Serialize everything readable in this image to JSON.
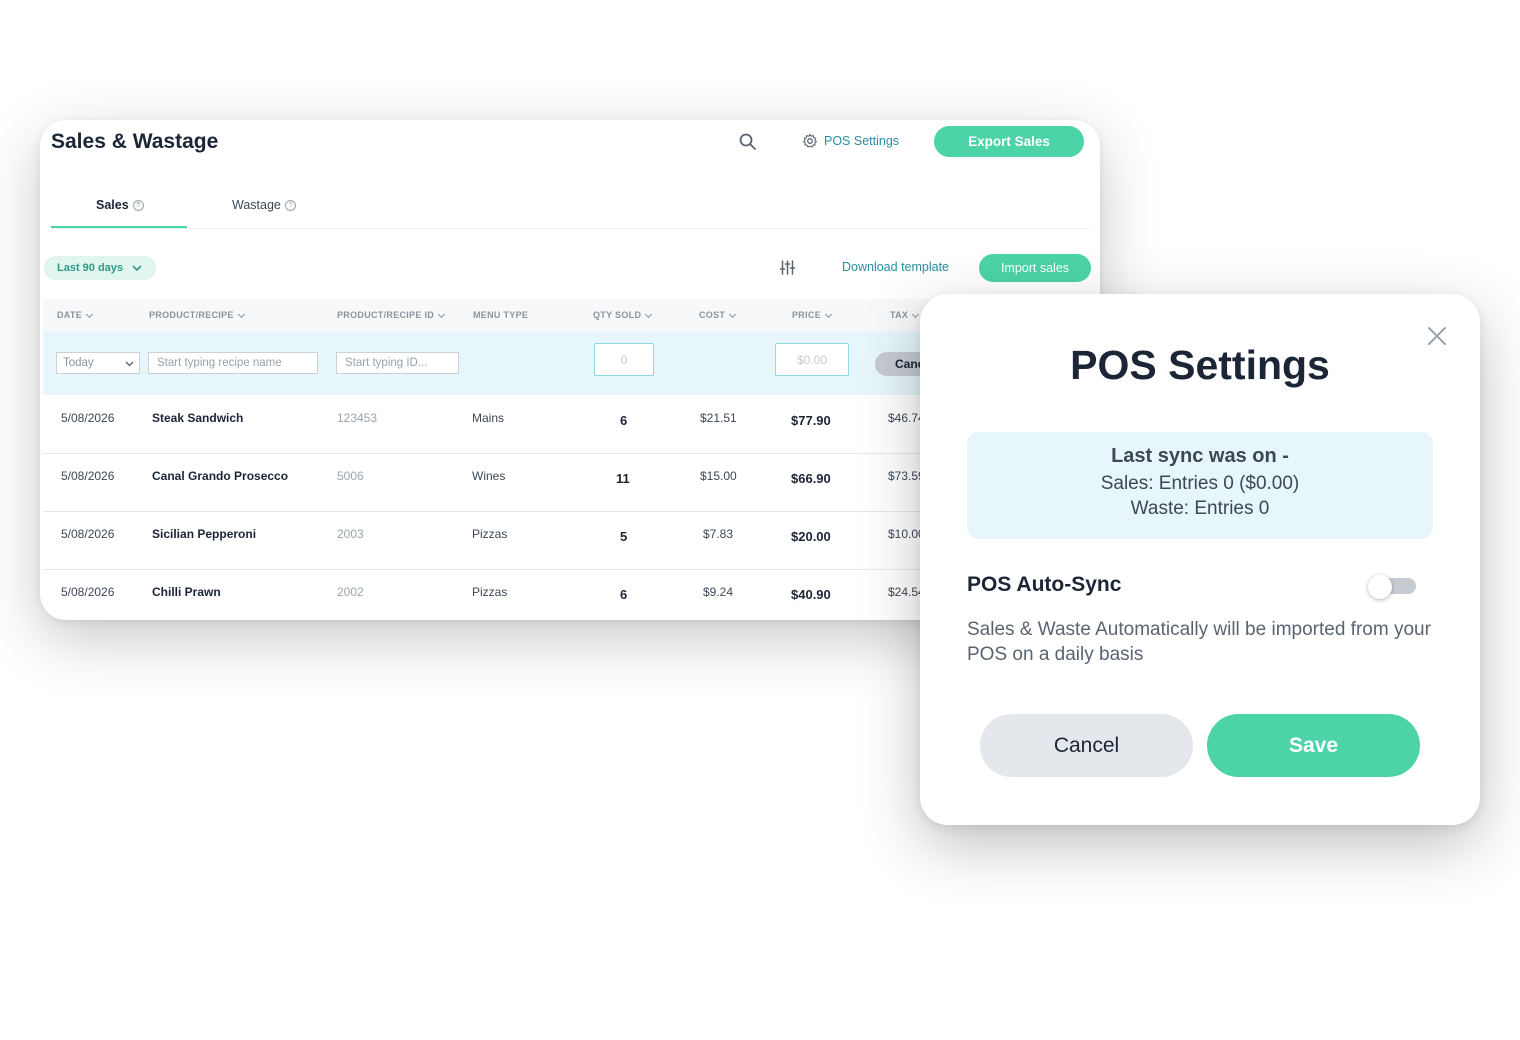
{
  "app": {
    "title": "Sales & Wastage",
    "pos_settings_label": "POS Settings",
    "export_label": "Export Sales"
  },
  "tabs": [
    {
      "label": "Sales"
    },
    {
      "label": "Wastage"
    }
  ],
  "toolbar": {
    "date_range": "Last 90 days",
    "download_label": "Download template",
    "import_label": "Import sales"
  },
  "table": {
    "columns": [
      "DATE",
      "PRODUCT/RECIPE",
      "PRODUCT/RECIPE ID",
      "MENU TYPE",
      "QTY SOLD",
      "COST",
      "PRICE",
      "TAX"
    ],
    "input_row": {
      "date_value": "Today",
      "recipe_placeholder": "Start typing recipe name",
      "id_placeholder": "Start typing ID...",
      "qty_placeholder": "0",
      "price_placeholder": "$0.00",
      "cancel_label": "Canc"
    },
    "rows": [
      {
        "date": "5/08/2026",
        "product": "Steak Sandwich",
        "id": "123453",
        "menu": "Mains",
        "qty": "6",
        "cost": "$21.51",
        "price": "$77.90",
        "tax": "$46.74"
      },
      {
        "date": "5/08/2026",
        "product": "Canal Grando Prosecco",
        "id": "5006",
        "menu": "Wines",
        "qty": "11",
        "cost": "$15.00",
        "price": "$66.90",
        "tax": "$73.59"
      },
      {
        "date": "5/08/2026",
        "product": "Sicilian Pepperoni",
        "id": "2003",
        "menu": "Pizzas",
        "qty": "5",
        "cost": "$7.83",
        "price": "$20.00",
        "tax": "$10.00"
      },
      {
        "date": "5/08/2026",
        "product": "Chilli Prawn",
        "id": "2002",
        "menu": "Pizzas",
        "qty": "6",
        "cost": "$9.24",
        "price": "$40.90",
        "tax": "$24.54"
      }
    ]
  },
  "modal": {
    "title": "POS Settings",
    "sync_title": "Last sync was on -",
    "sync_sales": "Sales: Entries 0 ($0.00)",
    "sync_waste": "Waste: Entries 0",
    "auto_sync_label": "POS Auto-Sync",
    "auto_sync_enabled": false,
    "auto_sync_desc": "Sales & Waste Automatically will be imported from your POS on a daily basis",
    "cancel_label": "Cancel",
    "save_label": "Save"
  },
  "colors": {
    "accent": "#4cd3a7",
    "link": "#2a8fa0",
    "input_row_bg": "#e6f6fa"
  }
}
